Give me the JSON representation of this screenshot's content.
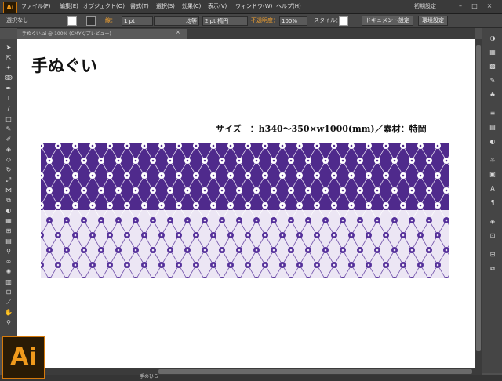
{
  "app": {
    "logo": "Ai"
  },
  "menu": [
    "ファイル(F)",
    "編集(E)",
    "オブジェクト(O)",
    "書式(T)",
    "選択(S)",
    "効果(C)",
    "表示(V)",
    "ウィンドウ(W)",
    "ヘルプ(H)"
  ],
  "workspace_label": "初期設定",
  "control": {
    "selection": "選択なし",
    "stroke_label": "線：",
    "stroke_weight": "1 pt",
    "uniform": "均等",
    "brush": "2 pt 楕円",
    "opacity_label": "不透明度：",
    "opacity": "100%",
    "style_label": "スタイル：",
    "doc_settings": "ドキュメント設定",
    "preferences": "環境設定"
  },
  "tab": {
    "label": "手ぬぐい.ai @ 100% (CMYK/プレビュー)",
    "close": "×"
  },
  "artwork": {
    "title": "手ぬぐい",
    "spec": "サイズ　：h340～350×w1000(mm)／素材：特岡",
    "colors": {
      "dark": "#4f2a8c",
      "light": "#ece6f4",
      "motif_light": "#ffffff",
      "motif_dark": "#55309a"
    }
  },
  "status": {
    "text": "手のひら"
  }
}
